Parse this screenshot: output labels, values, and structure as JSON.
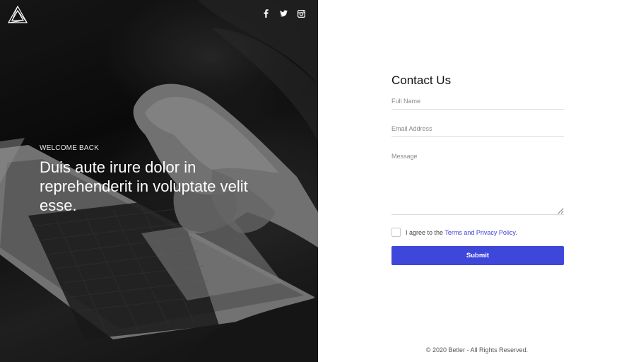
{
  "hero": {
    "eyebrow": "WELCOME BACK",
    "heading": "Duis aute irure dolor in reprehenderit in voluptate velit esse.",
    "logo_icon": "triangle-logo-icon",
    "socials": [
      {
        "icon": "facebook-icon"
      },
      {
        "icon": "twitter-icon"
      },
      {
        "icon": "instagram-icon"
      }
    ]
  },
  "form": {
    "title": "Contact Us",
    "full_name": {
      "placeholder": "Full Name",
      "value": ""
    },
    "email": {
      "placeholder": "Email Address",
      "value": ""
    },
    "message": {
      "placeholder": "Message",
      "value": ""
    },
    "agree": {
      "checked": false,
      "text": "I agree to the",
      "link_text": "Terms and Privacy Policy."
    },
    "submit_label": "Submit"
  },
  "footer": {
    "copyright": "© 2020 Betler - All Rights Reserved."
  },
  "colors": {
    "accent": "#3f47da",
    "link": "#3d45d4",
    "hero_text": "#ffffff"
  }
}
